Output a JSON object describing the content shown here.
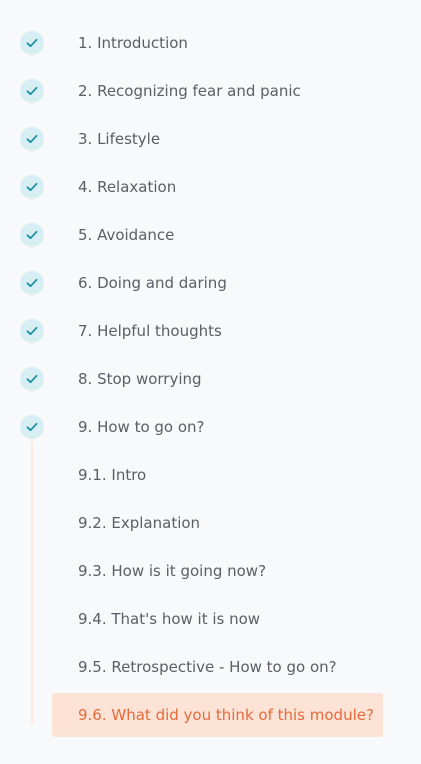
{
  "nav": {
    "modules": [
      {
        "label": "1. Introduction",
        "completed": true
      },
      {
        "label": "2. Recognizing fear and panic",
        "completed": true
      },
      {
        "label": "3. Lifestyle",
        "completed": true
      },
      {
        "label": "4. Relaxation",
        "completed": true
      },
      {
        "label": "5. Avoidance",
        "completed": true
      },
      {
        "label": "6. Doing and daring",
        "completed": true
      },
      {
        "label": "7. Helpful thoughts",
        "completed": true
      },
      {
        "label": "8. Stop worrying",
        "completed": true
      },
      {
        "label": "9. How to go on?",
        "completed": true
      }
    ],
    "subitems": [
      {
        "label": "9.1. Intro"
      },
      {
        "label": "9.2. Explanation"
      },
      {
        "label": "9.3. How is it going now?"
      },
      {
        "label": "9.4. That's how it is now"
      },
      {
        "label": "9.5. Retrospective - How to go on?"
      },
      {
        "label": "9.6. What did you think of this module?",
        "active": true
      }
    ]
  },
  "colors": {
    "background": "#f7f9fb",
    "check_bg": "#d7eff2",
    "check_mark": "#1d8fa3",
    "active_bg": "#fde3d6",
    "active_text": "#e56a3c",
    "text": "#5a5f66"
  },
  "icons": {
    "completed": "checkmark-icon"
  }
}
